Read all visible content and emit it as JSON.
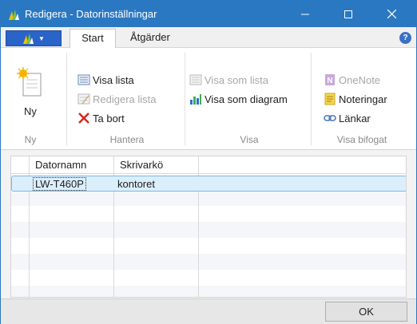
{
  "window": {
    "title": "Redigera - Datorinställningar"
  },
  "tabs": {
    "start": "Start",
    "actions": "Åtgärder"
  },
  "ribbon": {
    "ny": {
      "new_label": "Ny",
      "group_label": "Ny"
    },
    "hantera": {
      "view_list": "Visa lista",
      "edit_list": "Redigera lista",
      "delete": "Ta bort",
      "group_label": "Hantera"
    },
    "visa": {
      "view_as_list": "Visa som lista",
      "view_as_chart": "Visa som diagram",
      "group_label": "Visa"
    },
    "bifogat": {
      "onenote": "OneNote",
      "notes": "Noteringar",
      "links": "Länkar",
      "group_label": "Visa bifogat"
    }
  },
  "table": {
    "columns": [
      "Datornamn",
      "Skrivarkö"
    ],
    "rows": [
      {
        "computer_name": "LW-T460P",
        "printer_queue": "kontoret"
      }
    ]
  },
  "footer": {
    "ok_label": "OK"
  },
  "colors": {
    "titlebar": "#2b78c2",
    "selection": "#dbeefb",
    "disabled_text": "#a7a7a7"
  }
}
